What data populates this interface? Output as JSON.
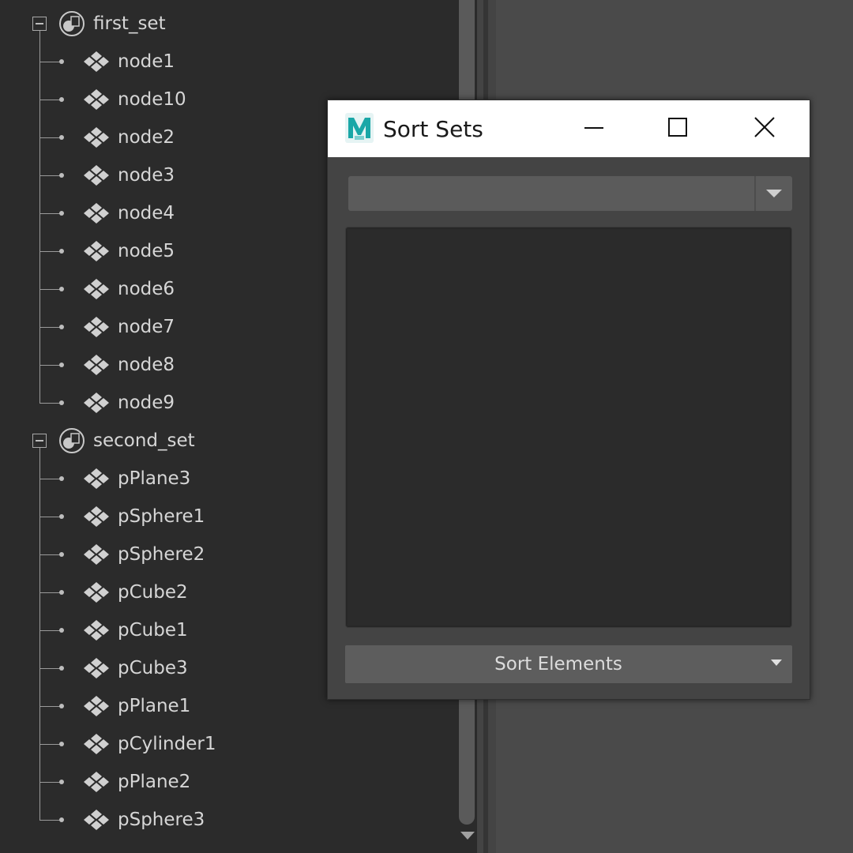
{
  "outliner": {
    "sets": [
      {
        "name": "first_set",
        "icon": "set-icon",
        "expanded": true,
        "members": [
          "node1",
          "node10",
          "node2",
          "node3",
          "node4",
          "node5",
          "node6",
          "node7",
          "node8",
          "node9"
        ]
      },
      {
        "name": "second_set",
        "icon": "set-icon",
        "expanded": true,
        "members": [
          "pPlane3",
          "pSphere1",
          "pSphere2",
          "pCube2",
          "pCube1",
          "pCube3",
          "pPlane1",
          "pCylinder1",
          "pPlane2",
          "pSphere3"
        ]
      }
    ],
    "member_icon": "transform-node-icon"
  },
  "dialog": {
    "title": "Sort Sets",
    "logo": "maya-logo-icon",
    "window_buttons": [
      "minimize-icon",
      "maximize-icon",
      "close-icon"
    ],
    "set_dropdown": {
      "selected": ""
    },
    "sort_button": {
      "label": "Sort Elements",
      "icon": "chevron-down-icon"
    }
  },
  "colors": {
    "outliner_bg": "#2b2b2b",
    "dialog_bg": "#444444",
    "titlebar_bg": "#ffffff",
    "text": "#d6d6d6"
  }
}
